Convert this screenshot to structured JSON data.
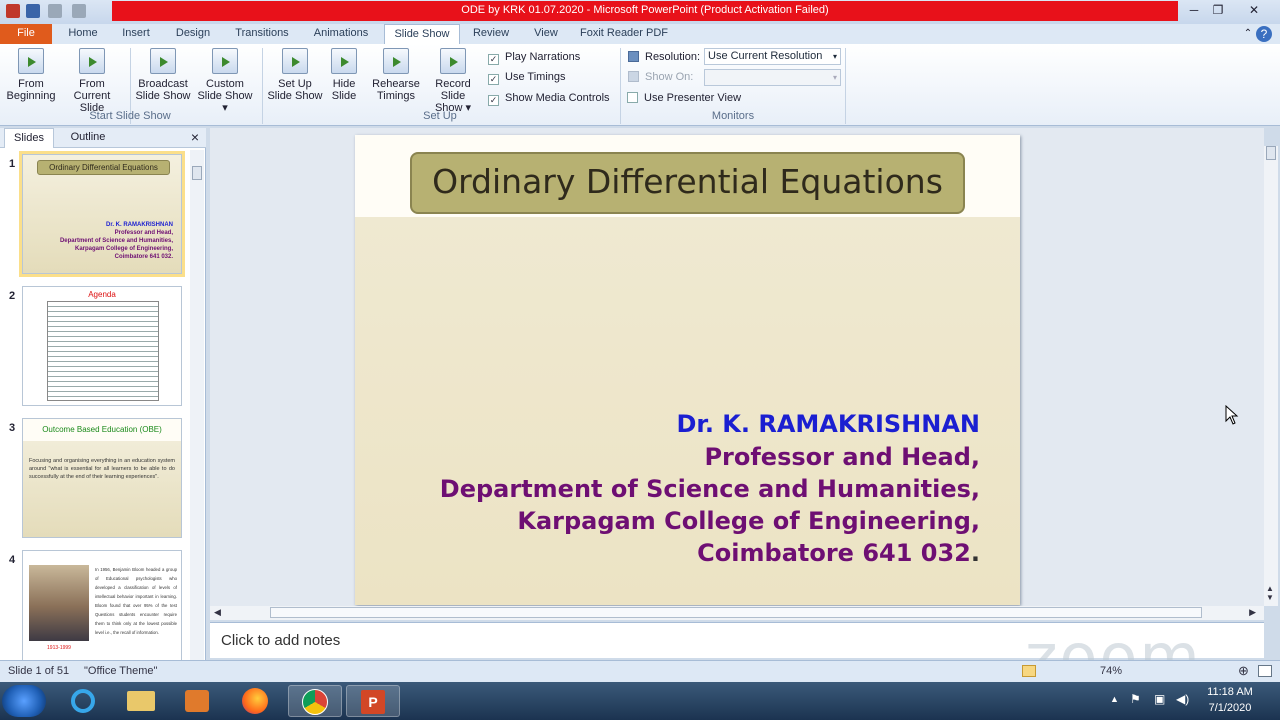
{
  "window": {
    "title": "ODE by KRK 01.07.2020  -  Microsoft PowerPoint (Product Activation Failed)",
    "controls": [
      "─",
      "❐",
      "✕"
    ]
  },
  "tabs": [
    "File",
    "Home",
    "Insert",
    "Design",
    "Transitions",
    "Animations",
    "Slide Show",
    "Review",
    "View",
    "Foxit Reader PDF"
  ],
  "ribbon": {
    "start": {
      "from_beginning": [
        "From",
        "Beginning"
      ],
      "from_current": [
        "From",
        "Current Slide"
      ],
      "broadcast": [
        "Broadcast",
        "Slide Show"
      ],
      "custom": [
        "Custom",
        "Slide Show ▾"
      ],
      "group": "Start Slide Show"
    },
    "setup": {
      "setup_show": [
        "Set Up",
        "Slide Show"
      ],
      "hide_slide": [
        "Hide",
        "Slide"
      ],
      "rehearse": [
        "Rehearse",
        "Timings"
      ],
      "record": [
        "Record Slide",
        "Show ▾"
      ],
      "play_narrations": "Play Narrations",
      "use_timings": "Use Timings",
      "show_media": "Show Media Controls",
      "group": "Set Up"
    },
    "monitors": {
      "resolution_label": "Resolution:",
      "resolution_value": "Use Current Resolution",
      "show_on_label": "Show On:",
      "presenter_view": "Use Presenter View",
      "group": "Monitors"
    }
  },
  "panel": {
    "tab_slides": "Slides",
    "tab_outline": "Outline",
    "close": "×",
    "thumbs": [
      {
        "num": "1",
        "title": "Ordinary Differential  Equations",
        "lines": [
          "Dr. K. RAMAKRISHNAN",
          "Professor and Head,",
          "Department  of Science and Humanities,",
          "Karpagam  College of Engineering,",
          "Coimbatore  641 032."
        ]
      },
      {
        "num": "2",
        "title": "Agenda"
      },
      {
        "num": "3",
        "title": "Outcome  Based  Education  (OBE)",
        "body": "Focusing and organising everything in an education system around \"what is essential for all learners to be able to do successfully at the end of their learning experiences\"."
      },
      {
        "num": "4",
        "body": "In 1956, Benjamin Bloom headed a group of Educational psychologists who developed a classification of levels of intellectual behavior important in learning. Bloom found that over 95% of the test Questions students encounter require them to think only at the lowest possible level i.e., the recall of information.",
        "caption": "1913-1999"
      }
    ]
  },
  "slide": {
    "title": "Ordinary  Differential  Equations",
    "name": "Dr. K. RAMAKRISHNAN",
    "line1": "Professor and Head,",
    "line2": "Department of Science and Humanities,",
    "line3": "Karpagam College of Engineering,",
    "line4": "Coimbatore 641 032",
    "line4_end": "."
  },
  "notes_placeholder": "Click to add notes",
  "status": {
    "slide": "Slide 1 of 51",
    "theme": "\"Office Theme\"",
    "zoom": "74%"
  },
  "taskbar": {
    "time": "11:18 AM",
    "date": "7/1/2020"
  },
  "watermark": "zoom",
  "colors": {
    "title_red": "#e8111a",
    "file_tab": "#e05b1c",
    "name_blue": "#1b1fd1",
    "purple": "#6e0f73"
  }
}
